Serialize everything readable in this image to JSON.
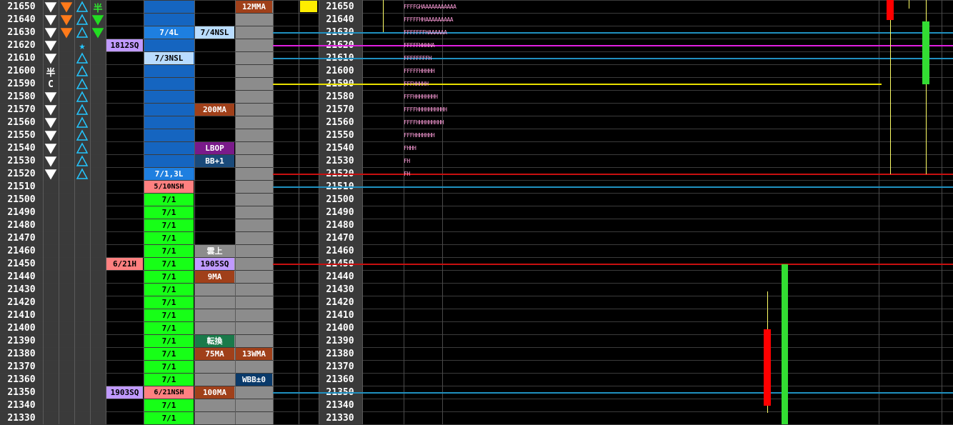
{
  "prices": [
    "21650",
    "21640",
    "21630",
    "21620",
    "21610",
    "21600",
    "21590",
    "21580",
    "21570",
    "21560",
    "21550",
    "21540",
    "21530",
    "21520",
    "21510",
    "21500",
    "21490",
    "21480",
    "21470",
    "21460",
    "21450",
    "21440",
    "21430",
    "21420",
    "21410",
    "21400",
    "21390",
    "21380",
    "21370",
    "21360",
    "21350",
    "21340",
    "21330"
  ],
  "signals": [
    [
      "tri-down",
      "tri-down-orange",
      "tri-up-outline",
      "半"
    ],
    [
      "tri-down",
      "tri-down-orange",
      "tri-up-outline",
      "tri-down-green"
    ],
    [
      "tri-down",
      "tri-down-orange",
      "tri-up-outline",
      "tri-down-green"
    ],
    [
      "tri-down",
      "",
      "star",
      ""
    ],
    [
      "tri-down",
      "",
      "tri-up-outline",
      ""
    ],
    [
      "半",
      "",
      "tri-up-outline",
      ""
    ],
    [
      "C",
      "",
      "tri-up-outline",
      ""
    ],
    [
      "tri-down",
      "",
      "tri-up-outline",
      ""
    ],
    [
      "tri-down",
      "",
      "tri-up-outline",
      ""
    ],
    [
      "tri-down",
      "",
      "tri-up-outline",
      ""
    ],
    [
      "tri-down",
      "",
      "tri-up-outline",
      ""
    ],
    [
      "tri-down",
      "",
      "tri-up-outline",
      ""
    ],
    [
      "tri-down",
      "",
      "tri-up-outline",
      ""
    ],
    [
      "tri-down",
      "",
      "tri-up-outline",
      ""
    ]
  ],
  "labels": [
    {
      "row": 2,
      "col": "c7",
      "text": "7/4L",
      "bg": "#1e7fe0",
      "fg": "#fff"
    },
    {
      "row": 2,
      "col": "c8",
      "text": "7/4NSL",
      "bg": "#b9dcff",
      "fg": "#000"
    },
    {
      "row": 3,
      "col": "c6",
      "text": "1812SQ",
      "bg": "#c09aff",
      "fg": "#000"
    },
    {
      "row": 4,
      "col": "c7",
      "text": "7/3NSL",
      "bg": "#b9dcff",
      "fg": "#000"
    },
    {
      "row": 0,
      "col": "c9",
      "text": "12MMA",
      "bg": "#a0401a",
      "fg": "#fff"
    },
    {
      "row": 8,
      "col": "c8",
      "text": "200MA",
      "bg": "#a0401a",
      "fg": "#fff"
    },
    {
      "row": 11,
      "col": "c8",
      "text": "LBOP",
      "bg": "#7a1a8a",
      "fg": "#fff"
    },
    {
      "row": 12,
      "col": "c8",
      "text": "BB+1",
      "bg": "#1a4a7a",
      "fg": "#fff"
    },
    {
      "row": 13,
      "col": "c7",
      "text": "7/1,3L",
      "bg": "#1e7fe0",
      "fg": "#fff"
    },
    {
      "row": 14,
      "col": "c7",
      "text": "5/10NSH",
      "bg": "#ff8080",
      "fg": "#000"
    },
    {
      "row": 19,
      "col": "c8",
      "text": "雲上",
      "bg": "",
      "fg": "#fff"
    },
    {
      "row": 20,
      "col": "c6",
      "text": "6/21H",
      "bg": "#ff8080",
      "fg": "#000"
    },
    {
      "row": 20,
      "col": "c8",
      "text": "1905SQ",
      "bg": "#c09aff",
      "fg": "#000"
    },
    {
      "row": 21,
      "col": "c8",
      "text": "9MA",
      "bg": "#a0401a",
      "fg": "#fff"
    },
    {
      "row": 26,
      "col": "c8",
      "text": "転換",
      "bg": "#1a7a4a",
      "fg": "#fff"
    },
    {
      "row": 27,
      "col": "c8",
      "text": "75MA",
      "bg": "#a0401a",
      "fg": "#fff"
    },
    {
      "row": 27,
      "col": "c9",
      "text": "13WMA",
      "bg": "#a0401a",
      "fg": "#fff"
    },
    {
      "row": 29,
      "col": "c9",
      "text": "WBB±0",
      "bg": "#0a3a6a",
      "fg": "#fff"
    },
    {
      "row": 30,
      "col": "c6",
      "text": "1903SQ",
      "bg": "#c09aff",
      "fg": "#000"
    },
    {
      "row": 30,
      "col": "c7",
      "text": "6/21NSH",
      "bg": "#ff8080",
      "fg": "#000"
    },
    {
      "row": 30,
      "col": "c8",
      "text": "100MA",
      "bg": "#a0401a",
      "fg": "#fff"
    }
  ],
  "green_rows": {
    "from": 15,
    "to": 32,
    "text": "7/1",
    "skip": [
      30
    ]
  },
  "tpo_profile": [
    "FFFFGHAAAAAAAAAAA",
    "FFFFFHHAAAAAAAAA",
    "FFFFFFFHAAAAAA",
    "FFFFFHHHHA",
    "FFFFFFFFH",
    "FFFFFHHHHH",
    "FFFHHHHH",
    "FFFHHHHHHHH",
    "FFFFHHHHHHHHHH",
    "FFFFHHHHHHHHH",
    "FFFHHHHHHH",
    "FHHH",
    "FH",
    "FH"
  ],
  "colors": {
    "green": "#17ff17",
    "yellow_marker": "#ffee00",
    "red_candle": "#ff0000",
    "green_candle": "#33dd33",
    "magenta_line": "#e020e0",
    "cyan_line": "#2090c0",
    "yellow_line": "#e8e000",
    "red_line": "#c81010"
  }
}
